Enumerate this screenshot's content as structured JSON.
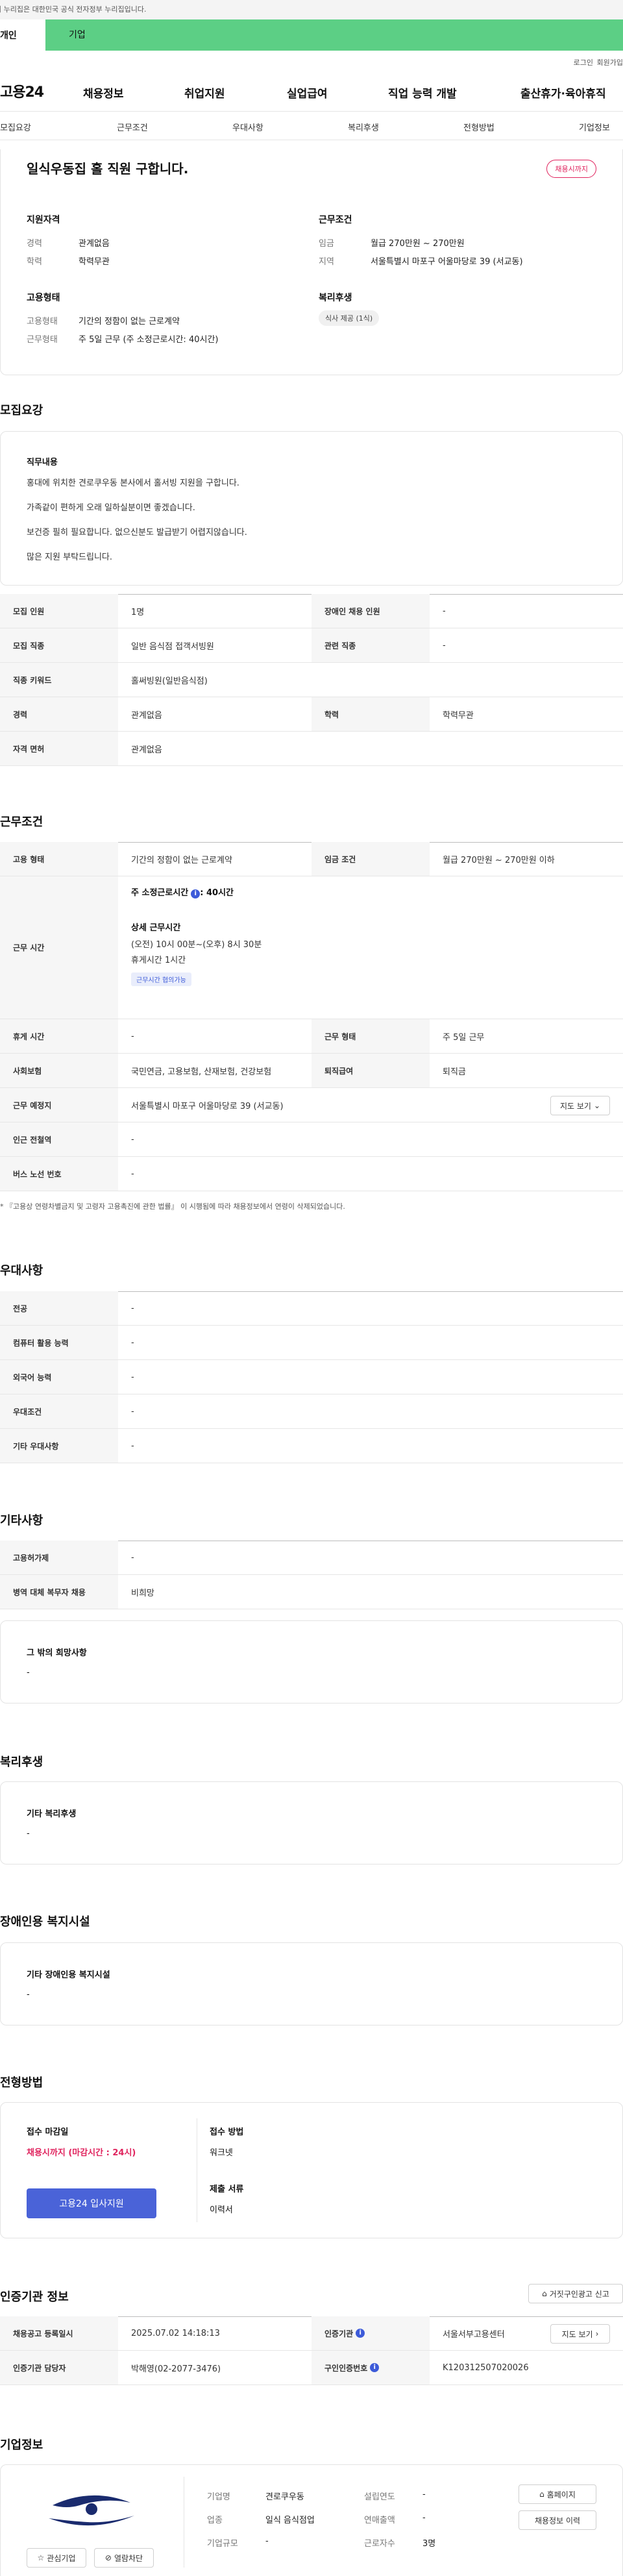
{
  "gov_banner": "이 누리집은 대한민국 공식 전자정부 누리집입니다.",
  "top_tabs": {
    "left": "개인",
    "right": "기업"
  },
  "util": {
    "login": "로그인",
    "join": "회원가입"
  },
  "gnb": {
    "logo": "고용24",
    "menu": [
      "채용정보",
      "취업지원",
      "실업급여",
      "직업 능력 개발",
      "출산휴가·육아휴직"
    ]
  },
  "subnav": [
    "모집요강",
    "근무조건",
    "우대사항",
    "복리후생",
    "전형방법",
    "기업정보"
  ],
  "summary": {
    "title": "일식우동집 홀 직원 구합니다.",
    "deadline_badge": "채용시까지",
    "qual_title": "지원자격",
    "qual": [
      {
        "k": "경력",
        "v": "관계없음"
      },
      {
        "k": "학력",
        "v": "학력무관"
      }
    ],
    "cond_title": "근무조건",
    "cond": [
      {
        "k": "임금",
        "v": "월급 270만원 ~ 270만원"
      },
      {
        "k": "지역",
        "v": "서울특별시 마포구 어울마당로 39 (서교동)"
      }
    ],
    "emp_title": "고용형태",
    "emp": [
      {
        "k": "고용형태",
        "v": "기간의 정함이 없는 근로계약"
      },
      {
        "k": "근무형태",
        "v": "주 5일 근무 (주 소정근로시간: 40시간)"
      }
    ],
    "welfare_title": "복리후생",
    "welfare_tag": "식사 제공 (1식)"
  },
  "recruit": {
    "title": "모집요강",
    "job_title": "직무내용",
    "job_lines": [
      "홍대에 위치한 견로쿠우동 본사에서 홀서빙 지원을 구합니다.",
      "가족같이 편하게 오래 일하실분이면 좋겠습니다.",
      "보건증 필히 필요합니다. 없으신분도 발급받기 어렵지않습니다.",
      "많은 지원 부탁드립니다."
    ],
    "rows": [
      {
        "k1": "모집 인원",
        "v1": "1명",
        "k2": "장애인 채용 인원",
        "v2": "-"
      },
      {
        "k1": "모집 직종",
        "v1": "일반 음식점 접객서빙원",
        "k2": "관련 직종",
        "v2": "-"
      },
      {
        "k1": "직종 키워드",
        "v1": "홀써빙원(일반음식점)"
      },
      {
        "k1": "경력",
        "v1": "관계없음",
        "k2": "학력",
        "v2": "학력무관"
      },
      {
        "k1": "자격 면허",
        "v1": "관계없음"
      }
    ]
  },
  "work": {
    "title": "근무조건",
    "emp_type_k": "고용 형태",
    "emp_type_v": "기간의 정함이 없는 근로계약",
    "wage_k": "임금 조건",
    "wage_v": "월급 270만원 ~ 270만원 이하",
    "hours_k": "근무 시간",
    "hours_weekly": "주 소정근로시간",
    "hours_weekly_v": ": 40시간",
    "hours_detail_title": "상세 근무시간",
    "hours_detail": "(오전) 10시 00분~(오후) 8시 30분",
    "hours_rest": "휴게시간 1시간",
    "hours_tag": "근무시간 협의가능",
    "rest_k": "휴게 시간",
    "rest_v": "-",
    "shift_k": "근무 형태",
    "shift_v": "주 5일 근무",
    "ins_k": "사회보험",
    "ins_v": "국민연금, 고용보험, 산재보험, 건강보험",
    "sev_k": "퇴직급여",
    "sev_v": "퇴직금",
    "place_k": "근무 예정지",
    "place_v": "서울특별시 마포구 어울마당로 39 (서교동)",
    "map_btn": "지도 보기",
    "subway_k": "인근 전철역",
    "subway_v": "-",
    "bus_k": "버스 노선 번호",
    "bus_v": "-",
    "note": "* 『고용상 연령차별금지 및 고령자 고용촉진에 관한 법률』 이 시행됨에 따라 채용정보에서 연령이 삭제되었습니다."
  },
  "pref": {
    "title": "우대사항",
    "rows": [
      {
        "k": "전공",
        "v": "-"
      },
      {
        "k": "컴퓨터 활용 능력",
        "v": "-"
      },
      {
        "k": "외국어 능력",
        "v": "-"
      },
      {
        "k": "우대조건",
        "v": "-"
      },
      {
        "k": "기타 우대사항",
        "v": "-"
      }
    ]
  },
  "etc": {
    "title": "기타사항",
    "rows": [
      {
        "k": "고용허가제",
        "v": "-"
      },
      {
        "k": "병역 대체 복무자 채용",
        "v": "비희망"
      }
    ],
    "box_title": "그 밖의 희망사항",
    "box_v": "-"
  },
  "welfare": {
    "title": "복리후생",
    "box_title": "기타 복리후생",
    "box_v": "-"
  },
  "disabled": {
    "title": "장애인용 복지시설",
    "box_title": "기타 장애인용 복지시설",
    "box_v": "-"
  },
  "screening": {
    "title": "전형방법",
    "deadline_k": "접수 마감일",
    "deadline_v": "채용시까지 (마감시간 : 24시)",
    "apply_btn": "고용24 입사지원",
    "method_k": "접수 방법",
    "method_v": "워크넷",
    "docs_k": "제출 서류",
    "docs_v": "이력서"
  },
  "agency": {
    "title": "인증기관 정보",
    "report_btn": "거짓구인광고 신고",
    "rows": [
      {
        "k1": "채용공고 등록일시",
        "v1": "2025.07.02 14:18:13",
        "k2": "인증기관",
        "v2": "서울서부고용센터",
        "btn": "지도 보기"
      },
      {
        "k1": "인증기관 담당자",
        "v1": "박해영(02-2077-3476)",
        "k2": "구인인증번호",
        "v2": "K120312507020026"
      }
    ]
  },
  "company": {
    "title": "기업정보",
    "logo_text": "견로쿠우동",
    "fav_btn": "관심기업",
    "block_btn": "열람차단",
    "info": [
      {
        "k": "기업명",
        "v": "견로쿠우동"
      },
      {
        "k": "업종",
        "v": "일식 음식점업"
      },
      {
        "k": "기업규모",
        "v": "-"
      }
    ],
    "info2": [
      {
        "k": "설립연도",
        "v": "-"
      },
      {
        "k": "연매출액",
        "v": "-"
      },
      {
        "k": "근로자수",
        "v": "3명"
      }
    ],
    "home_btn": "홈페이지",
    "history_btn": "채용정보 이력"
  },
  "colors": {
    "accent": "#5ccf85",
    "primary": "#4a63d8",
    "danger": "#e0245e"
  }
}
